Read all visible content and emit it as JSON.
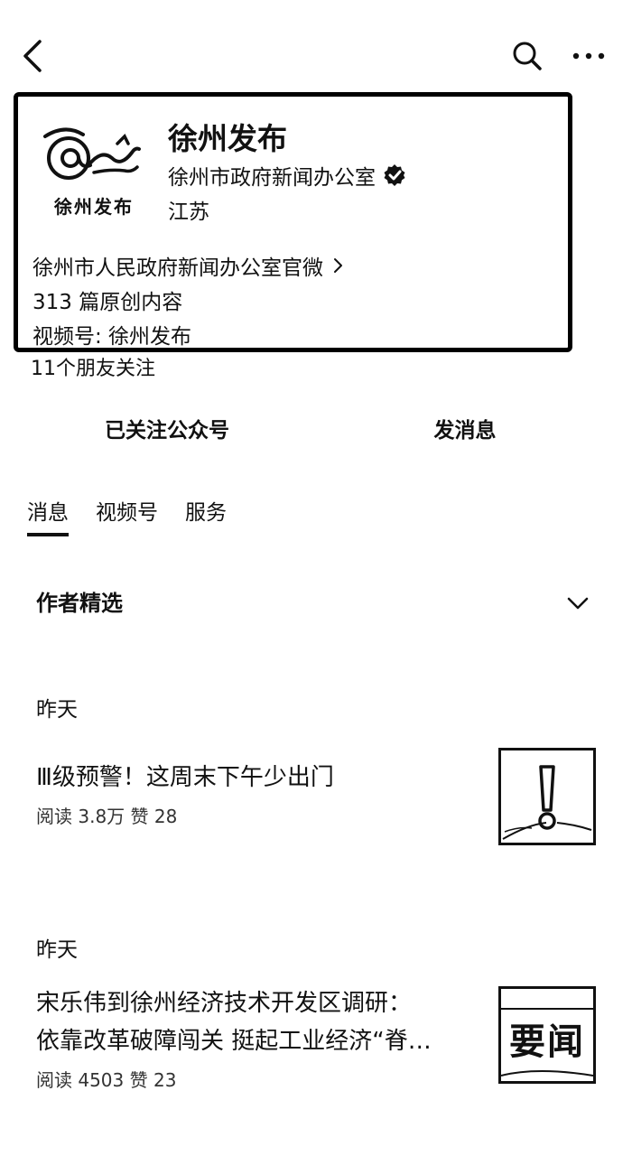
{
  "header": {
    "back_icon": "chevron-left-icon",
    "search_icon": "search-icon",
    "more_icon": "more-horizontal-icon"
  },
  "profile": {
    "logo_text": "徐州发布",
    "name": "徐州发布",
    "org": "徐州市政府新闻办公室",
    "region": "江苏",
    "description": "徐州市人民政府新闻办公室官微",
    "original_count": "313 篇原创内容",
    "channel": "视频号: 徐州发布"
  },
  "friends_text": "11个朋友关注",
  "actions": {
    "follow_label": "已关注公众号",
    "message_label": "发消息"
  },
  "tabs": [
    {
      "label": "消息",
      "active": true
    },
    {
      "label": "视频号",
      "active": false
    },
    {
      "label": "服务",
      "active": false
    }
  ],
  "section": {
    "title": "作者精选"
  },
  "articles": [
    {
      "date": "昨天",
      "title": "Ⅲ级预警！这周末下午少出门",
      "meta": "阅读 3.8万  赞 28"
    },
    {
      "date": "昨天",
      "title_line1": "宋乐伟到徐州经济技术开发区调研：",
      "title_line2": "依靠改革破障闯关 挺起工业经济“脊…",
      "meta": "阅读 4503  赞 23",
      "thumb_text": "要闻"
    }
  ]
}
